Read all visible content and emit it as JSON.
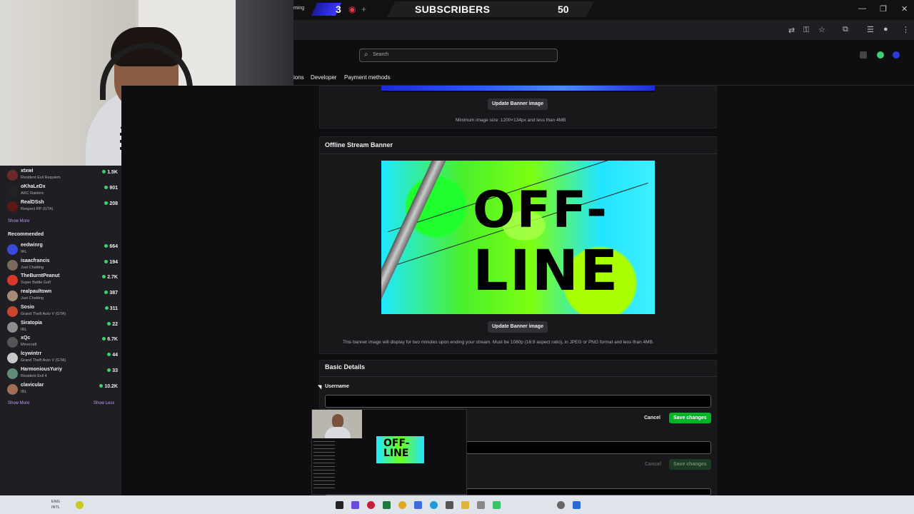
{
  "stream_overlay": {
    "corner_text": "ming",
    "counter": "3",
    "goal_title": "SUBSCRIBERS",
    "goal_count": "50"
  },
  "search": {
    "placeholder": "Search"
  },
  "tabs": [
    "ions",
    "Developer",
    "Payment methods"
  ],
  "sidebar": {
    "followed": [
      {
        "name": "xtxwi",
        "game": "Resident Evil Requiem",
        "viewers": "1.5K",
        "avatar_color": "#6b2a2a"
      },
      {
        "name": "oKhaLeDx",
        "game": "ARC Raiders",
        "viewers": "901",
        "avatar_color": "#222"
      },
      {
        "name": "RealDSsh",
        "game": "Respect RP (GTA)",
        "viewers": "208",
        "avatar_color": "#5a1a12"
      }
    ],
    "show_more_1": "Show More",
    "recommended_title": "Recommended",
    "recommended": [
      {
        "name": "eedwinrg",
        "game": "IRL",
        "viewers": "664",
        "avatar_color": "#3a4ad8"
      },
      {
        "name": "isaacfrancis",
        "game": "Just Chatting",
        "viewers": "194",
        "avatar_color": "#7a6a5a"
      },
      {
        "name": "TheBurntPeanut",
        "game": "Super Battle Golf",
        "viewers": "2.7K",
        "avatar_color": "#d8372a"
      },
      {
        "name": "realpaultown",
        "game": "Just Chatting",
        "viewers": "387",
        "avatar_color": "#a58a76"
      },
      {
        "name": "Sosio",
        "game": "Grand Theft Auto V (GTA)",
        "viewers": "311",
        "avatar_color": "#c9452e"
      },
      {
        "name": "Siratopia",
        "game": "IRL",
        "viewers": "22",
        "avatar_color": "#8c8c8c"
      },
      {
        "name": "xQc",
        "game": "Minecraft",
        "viewers": "6.7K",
        "avatar_color": "#555"
      },
      {
        "name": "lcywintrr",
        "game": "Grand Theft Auto V (GTA)",
        "viewers": "44",
        "avatar_color": "#c8c8c8"
      },
      {
        "name": "HarmoniousYuriy",
        "game": "Resident Evil 4",
        "viewers": "33",
        "avatar_color": "#5e8c76"
      },
      {
        "name": "clavicular",
        "game": "IRL",
        "viewers": "10.2K",
        "avatar_color": "#a06e55"
      }
    ],
    "show_more_2": "Show More",
    "show_less": "Show Less"
  },
  "settings": {
    "update_banner_button": "Update Banner image",
    "banner_note": "Minimum image size: 1200×134px and less than 4MB",
    "offline_title": "Offline Stream Banner",
    "offline_image_text_1": "OFF-",
    "offline_image_text_2": "LINE",
    "update_offline_button": "Update Banner image",
    "offline_note": "This banner image will display for two minutes upon ending your stream. Must be 1080p (16:9 aspect ratio), in JPEG or PNG format and less than 4MB.",
    "basic_title": "Basic Details",
    "username_label": "Username",
    "cancel": "Cancel",
    "save": "Save changes",
    "cancel_2": "Cancel",
    "save_2": "Save changes"
  },
  "pip": {
    "text": "OFF-LINE"
  },
  "taskbar": {
    "lang_top": "ENG",
    "lang_bottom": "INTL"
  },
  "colors": {
    "accent_green": "#00b523",
    "live_dot": "#3bd16f"
  }
}
